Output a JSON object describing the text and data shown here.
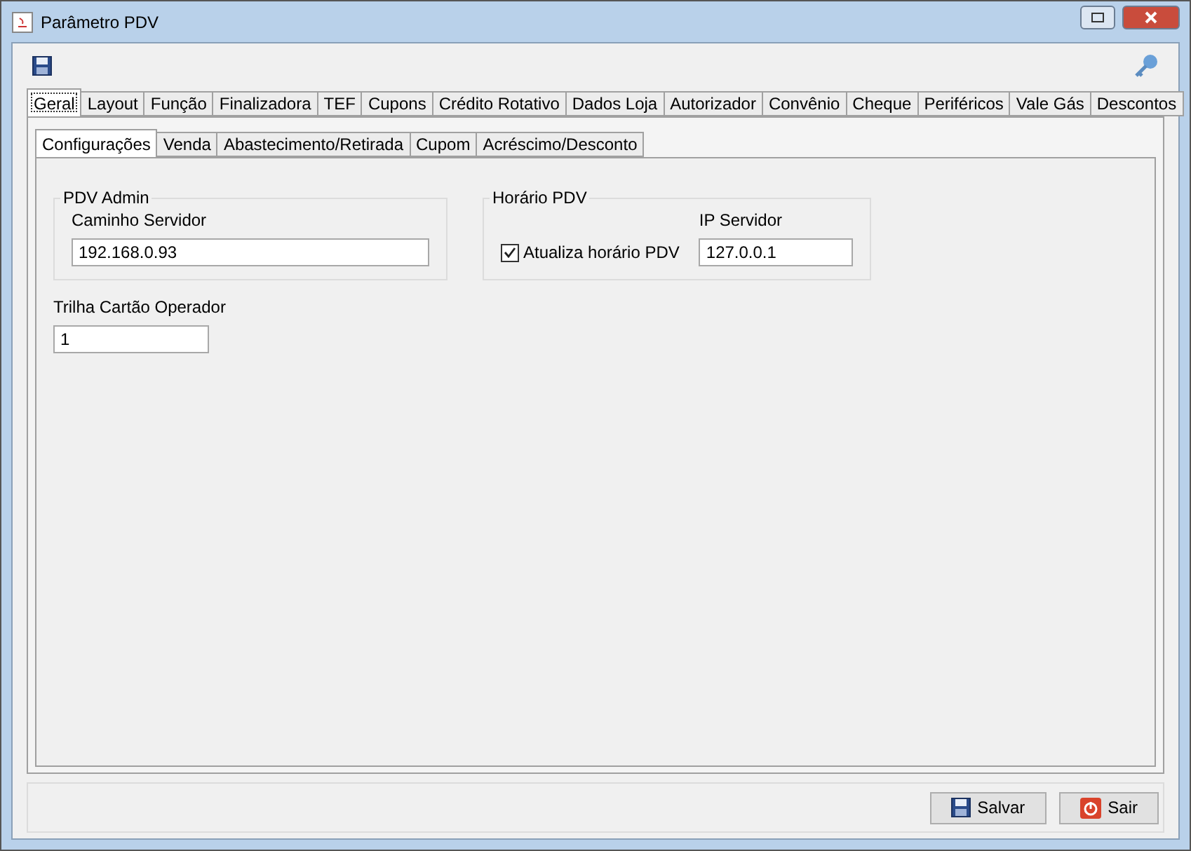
{
  "window": {
    "title": "Parâmetro PDV"
  },
  "tabs": [
    {
      "label": "Geral",
      "selected": true
    },
    {
      "label": "Layout",
      "selected": false
    },
    {
      "label": "Função",
      "selected": false
    },
    {
      "label": "Finalizadora",
      "selected": false
    },
    {
      "label": "TEF",
      "selected": false
    },
    {
      "label": "Cupons",
      "selected": false
    },
    {
      "label": "Crédito Rotativo",
      "selected": false
    },
    {
      "label": "Dados Loja",
      "selected": false
    },
    {
      "label": "Autorizador",
      "selected": false
    },
    {
      "label": "Convênio",
      "selected": false
    },
    {
      "label": "Cheque",
      "selected": false
    },
    {
      "label": "Periféricos",
      "selected": false
    },
    {
      "label": "Vale Gás",
      "selected": false
    },
    {
      "label": "Descontos",
      "selected": false
    }
  ],
  "subtabs": [
    {
      "label": "Configurações",
      "selected": true
    },
    {
      "label": "Venda",
      "selected": false
    },
    {
      "label": "Abastecimento/Retirada",
      "selected": false
    },
    {
      "label": "Cupom",
      "selected": false
    },
    {
      "label": "Acréscimo/Desconto",
      "selected": false
    }
  ],
  "pdv_admin": {
    "title": "PDV Admin",
    "label": "Caminho Servidor",
    "value": "192.168.0.93"
  },
  "horario_pdv": {
    "title": "Horário PDV",
    "checkbox": {
      "label": "Atualiza horário PDV",
      "checked": true
    },
    "label": "IP Servidor",
    "value": "127.0.0.1"
  },
  "trilha": {
    "label": "Trilha Cartão Operador",
    "value": "1"
  },
  "buttons": [
    {
      "kind": "save",
      "label": "Salvar"
    },
    {
      "kind": "exit",
      "label": "Sair"
    }
  ]
}
